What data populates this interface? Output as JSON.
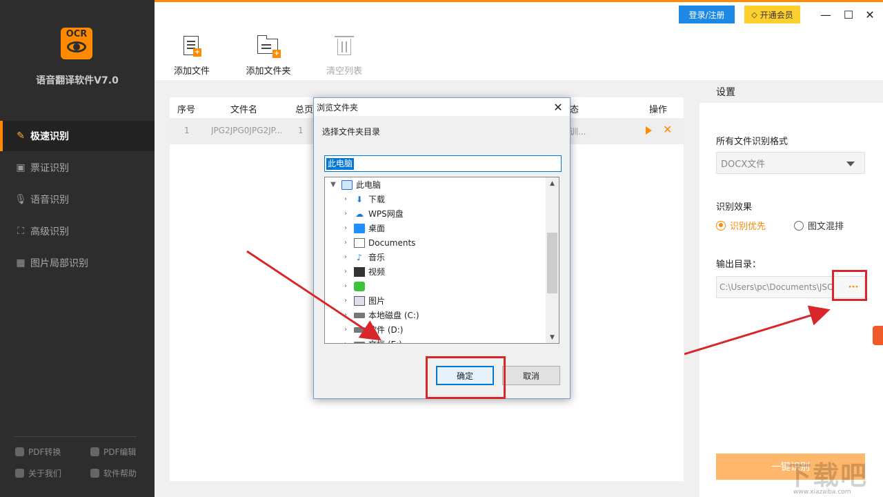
{
  "app": {
    "title": "语音翻译软件V7.0",
    "logo_text": "OCR",
    "accent": "#ff8a00"
  },
  "topbar": {
    "login_label": "登录/注册",
    "vip_label": "开通会员",
    "vip_icon": "diamond-icon",
    "minimize_glyph": "—",
    "maximize_glyph": "☐",
    "close_glyph": "✕"
  },
  "toolbar": {
    "add_file": "添加文件",
    "add_folder": "添加文件夹",
    "clear_list": "清空列表"
  },
  "sidebar": {
    "items": [
      {
        "label": "极速识别",
        "icon": "lightning-edit-icon",
        "active": true
      },
      {
        "label": "票证识别",
        "icon": "ticket-icon",
        "active": false
      },
      {
        "label": "语音识别",
        "icon": "microphone-icon",
        "active": false
      },
      {
        "label": "高级识别",
        "icon": "scan-icon",
        "active": false
      },
      {
        "label": "图片局部识别",
        "icon": "image-crop-icon",
        "active": false
      }
    ],
    "bottom_links": [
      {
        "label": "PDF转换",
        "icon": "pdf-convert-icon"
      },
      {
        "label": "PDF编辑",
        "icon": "pdf-edit-icon"
      },
      {
        "label": "关于我们",
        "icon": "about-icon"
      },
      {
        "label": "软件帮助",
        "icon": "help-icon"
      }
    ]
  },
  "table": {
    "headers": {
      "index": "序号",
      "filename": "文件名",
      "pages": "总页",
      "status": "态",
      "actions": "操作"
    },
    "rows": [
      {
        "index": "1",
        "filename": "JPG2JPG0JPG2JP...",
        "pages": "1",
        "status": "训..."
      }
    ]
  },
  "settings": {
    "header": "设置",
    "format_label": "所有文件识别格式",
    "format_value": "DOCX文件",
    "effect_label": "识别效果",
    "effect_options": [
      {
        "label": "识别优先",
        "selected": true
      },
      {
        "label": "图文混排",
        "selected": false
      }
    ],
    "output_label": "输出目录：",
    "output_value": "C:\\Users\\pc\\Documents\\JSO",
    "browse_label": "···",
    "start_label": "一键识别"
  },
  "dialog": {
    "title": "浏览文件夹",
    "description": "选择文件夹目录",
    "input_value": "此电脑",
    "tree": [
      {
        "label": "此电脑",
        "icon": "computer-icon",
        "expanded": true,
        "level": 0
      },
      {
        "label": "下载",
        "icon": "download-icon",
        "level": 1
      },
      {
        "label": "WPS网盘",
        "icon": "cloud-icon",
        "level": 1
      },
      {
        "label": "桌面",
        "icon": "desktop-icon",
        "level": 1
      },
      {
        "label": "Documents",
        "icon": "document-icon",
        "level": 1
      },
      {
        "label": "音乐",
        "icon": "music-icon",
        "level": 1
      },
      {
        "label": "视频",
        "icon": "video-icon",
        "level": 1
      },
      {
        "label": "",
        "icon": "iqiyi-icon",
        "level": 1
      },
      {
        "label": "图片",
        "icon": "picture-icon",
        "level": 1
      },
      {
        "label": "本地磁盘 (C:)",
        "icon": "drive-icon",
        "level": 1
      },
      {
        "label": "软件 (D:)",
        "icon": "drive-icon",
        "level": 1
      },
      {
        "label": "文档 (E:)",
        "icon": "drive-icon",
        "level": 1
      }
    ],
    "ok_label": "确定",
    "cancel_label": "取消"
  },
  "watermark": {
    "big": "下载吧",
    "small": "www.xiazaiba.com"
  }
}
